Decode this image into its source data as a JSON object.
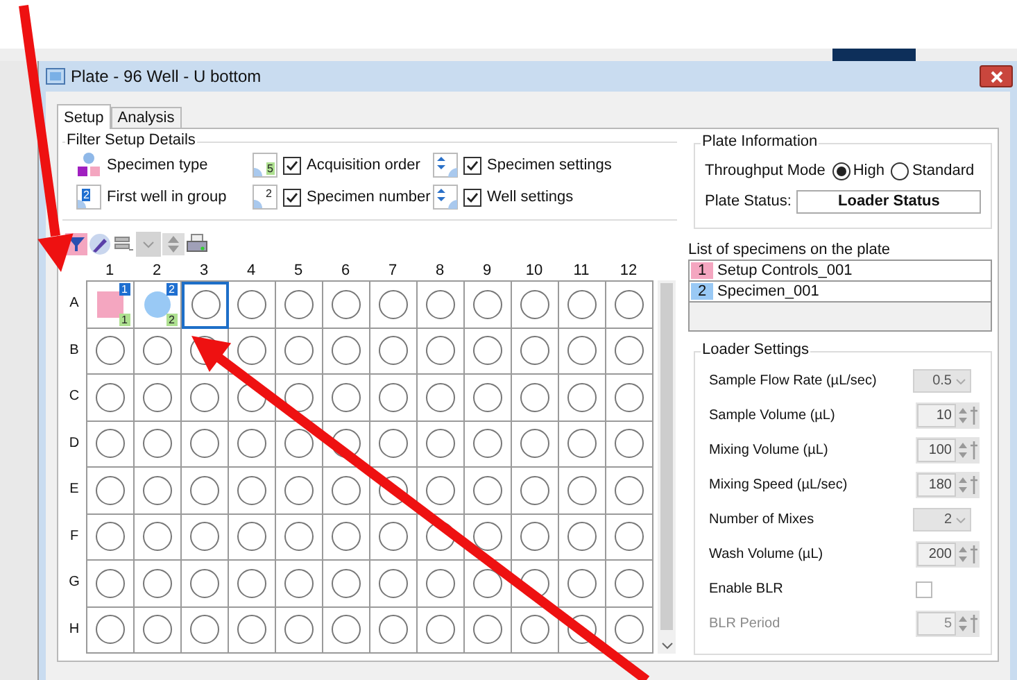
{
  "window": {
    "title": "Plate - 96 Well - U bottom"
  },
  "tabs": [
    {
      "label": "Setup",
      "selected": true
    },
    {
      "label": "Analysis",
      "selected": false
    }
  ],
  "filter_setup": {
    "title": "Filter Setup Details",
    "items": [
      {
        "kind": "legend",
        "label": "Specimen type"
      },
      {
        "kind": "checkbox",
        "label": "Acquisition order",
        "checked": true,
        "badge": "5"
      },
      {
        "kind": "checkbox",
        "label": "Specimen settings",
        "checked": true
      },
      {
        "kind": "legend",
        "label": "First well in group",
        "badge": "2"
      },
      {
        "kind": "checkbox",
        "label": "Specimen number",
        "checked": true,
        "badge": "2"
      },
      {
        "kind": "checkbox",
        "label": "Well settings",
        "checked": true
      }
    ]
  },
  "plate": {
    "columns": [
      "1",
      "2",
      "3",
      "4",
      "5",
      "6",
      "7",
      "8",
      "9",
      "10",
      "11",
      "12"
    ],
    "rows": [
      {
        "label": "A",
        "wells": [
          {
            "selected": false,
            "specimen": {
              "kind": "square",
              "color": "#f4a6c0",
              "number": "1",
              "order": "1"
            }
          },
          {
            "selected": false,
            "specimen": {
              "kind": "circle",
              "color": "#99c9f5",
              "number": "2",
              "order": "2"
            }
          },
          {
            "selected": true
          },
          {
            "selected": false
          },
          {
            "selected": false
          },
          {
            "selected": false
          },
          {
            "selected": false
          },
          {
            "selected": false
          },
          {
            "selected": false
          },
          {
            "selected": false
          },
          {
            "selected": false
          },
          {
            "selected": false
          }
        ]
      },
      {
        "label": "B",
        "wells": [
          {
            "selected": false
          },
          {
            "selected": false
          },
          {
            "selected": false
          },
          {
            "selected": false
          },
          {
            "selected": false
          },
          {
            "selected": false
          },
          {
            "selected": false
          },
          {
            "selected": false
          },
          {
            "selected": false
          },
          {
            "selected": false
          },
          {
            "selected": false
          },
          {
            "selected": false
          }
        ]
      },
      {
        "label": "C",
        "wells": [
          {
            "selected": false
          },
          {
            "selected": false
          },
          {
            "selected": false
          },
          {
            "selected": false
          },
          {
            "selected": false
          },
          {
            "selected": false
          },
          {
            "selected": false
          },
          {
            "selected": false
          },
          {
            "selected": false
          },
          {
            "selected": false
          },
          {
            "selected": false
          },
          {
            "selected": false
          }
        ]
      },
      {
        "label": "D",
        "wells": [
          {
            "selected": false
          },
          {
            "selected": false
          },
          {
            "selected": false
          },
          {
            "selected": false
          },
          {
            "selected": false
          },
          {
            "selected": false
          },
          {
            "selected": false
          },
          {
            "selected": false
          },
          {
            "selected": false
          },
          {
            "selected": false
          },
          {
            "selected": false
          },
          {
            "selected": false
          }
        ]
      },
      {
        "label": "E",
        "wells": [
          {
            "selected": false
          },
          {
            "selected": false
          },
          {
            "selected": false
          },
          {
            "selected": false
          },
          {
            "selected": false
          },
          {
            "selected": false
          },
          {
            "selected": false
          },
          {
            "selected": false
          },
          {
            "selected": false
          },
          {
            "selected": false
          },
          {
            "selected": false
          },
          {
            "selected": false
          }
        ]
      },
      {
        "label": "F",
        "wells": [
          {
            "selected": false
          },
          {
            "selected": false
          },
          {
            "selected": false
          },
          {
            "selected": false
          },
          {
            "selected": false
          },
          {
            "selected": false
          },
          {
            "selected": false
          },
          {
            "selected": false
          },
          {
            "selected": false
          },
          {
            "selected": false
          },
          {
            "selected": false
          },
          {
            "selected": false
          }
        ]
      },
      {
        "label": "G",
        "wells": [
          {
            "selected": false
          },
          {
            "selected": false
          },
          {
            "selected": false
          },
          {
            "selected": false
          },
          {
            "selected": false
          },
          {
            "selected": false
          },
          {
            "selected": false
          },
          {
            "selected": false
          },
          {
            "selected": false
          },
          {
            "selected": false
          },
          {
            "selected": false
          },
          {
            "selected": false
          }
        ]
      },
      {
        "label": "H",
        "wells": [
          {
            "selected": false
          },
          {
            "selected": false
          },
          {
            "selected": false
          },
          {
            "selected": false
          },
          {
            "selected": false
          },
          {
            "selected": false
          },
          {
            "selected": false
          },
          {
            "selected": false
          },
          {
            "selected": false
          },
          {
            "selected": false
          },
          {
            "selected": false
          },
          {
            "selected": false
          }
        ]
      }
    ]
  },
  "plate_information": {
    "title": "Plate Information",
    "throughput_label": "Throughput Mode",
    "modes": [
      {
        "label": "High",
        "selected": true
      },
      {
        "label": "Standard",
        "selected": false
      }
    ],
    "status_label": "Plate Status:",
    "status_value": "Loader Status"
  },
  "specimen_list": {
    "title": "List of specimens on the plate",
    "items": [
      {
        "number": "1",
        "name": "Setup Controls_001",
        "color": "#f4a6c0"
      },
      {
        "number": "2",
        "name": "Specimen_001",
        "color": "#99c9f5"
      }
    ]
  },
  "loader_settings": {
    "title": "Loader Settings",
    "items": [
      {
        "kind": "dropdown",
        "label": "Sample Flow Rate (µL/sec)",
        "value": "0.5",
        "disabled": false
      },
      {
        "kind": "spinner",
        "label": "Sample Volume (µL)",
        "value": "10",
        "disabled": false
      },
      {
        "kind": "spinner",
        "label": "Mixing Volume (µL)",
        "value": "100",
        "disabled": false
      },
      {
        "kind": "spinner",
        "label": "Mixing Speed (µL/sec)",
        "value": "180",
        "disabled": false
      },
      {
        "kind": "dropdown",
        "label": "Number of Mixes",
        "value": "2",
        "disabled": false
      },
      {
        "kind": "spinner",
        "label": "Wash Volume (µL)",
        "value": "200",
        "disabled": false
      },
      {
        "kind": "checkbox",
        "label": "Enable BLR",
        "checked": false,
        "disabled": false
      },
      {
        "kind": "spinner",
        "label": "BLR Period",
        "value": "5",
        "disabled": true
      }
    ]
  }
}
